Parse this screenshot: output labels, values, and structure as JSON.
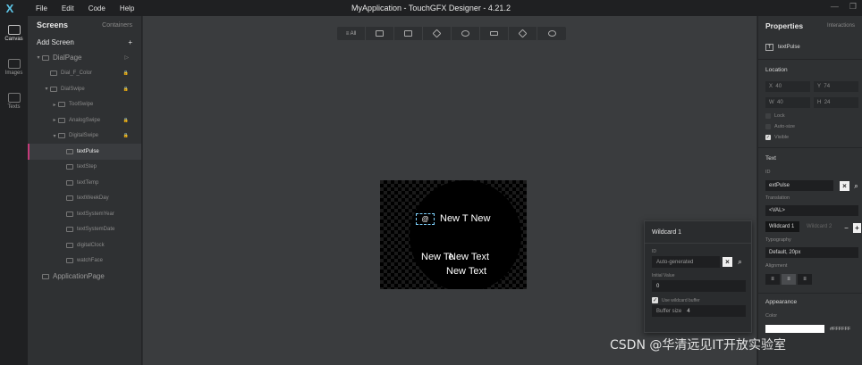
{
  "app": {
    "title": "MyApplication - TouchGFX Designer - 4.21.2",
    "menu": [
      "File",
      "Edit",
      "Code",
      "Help"
    ],
    "logo_glyph": "X"
  },
  "leftbar": [
    {
      "label": "Canvas",
      "icon": "canvas-icon",
      "active": true
    },
    {
      "label": "Images",
      "icon": "images-icon",
      "active": false
    },
    {
      "label": "Texts",
      "icon": "texts-icon",
      "active": false
    }
  ],
  "screens": {
    "tab_active": "Screens",
    "tab_other": "Containers",
    "add_label": "Add Screen",
    "add_glyph": "+",
    "tree": [
      {
        "label": "DialPage",
        "indent": 0,
        "kind": "screen",
        "arrow": "▾",
        "extra": "▷"
      },
      {
        "label": "Dial_F_Color",
        "indent": 1,
        "lock": true
      },
      {
        "label": "DialSwipe",
        "indent": 1,
        "arrow": "▾",
        "lock": true
      },
      {
        "label": "ToolSwipe",
        "indent": 2,
        "arrow": "▸"
      },
      {
        "label": "AnalogSwipe",
        "indent": 2,
        "arrow": "▸",
        "lock": true
      },
      {
        "label": "DigitalSwipe",
        "indent": 2,
        "arrow": "▾",
        "lock": true
      },
      {
        "label": "textPulse",
        "indent": 3,
        "selected": true
      },
      {
        "label": "textStep",
        "indent": 3
      },
      {
        "label": "textTemp",
        "indent": 3
      },
      {
        "label": "textWeekDay",
        "indent": 3
      },
      {
        "label": "textSystemYear",
        "indent": 3
      },
      {
        "label": "textSystemDate",
        "indent": 3
      },
      {
        "label": "digitalClock",
        "indent": 3
      },
      {
        "label": "watchFace",
        "indent": 3
      },
      {
        "label": "ApplicationPage",
        "indent": 0,
        "kind": "screen"
      }
    ]
  },
  "toolbar": {
    "all_label": "≡ All",
    "icons": [
      "display-icon",
      "image-icon",
      "container-icon",
      "shapes-icon",
      "button-icon",
      "cube-icon",
      "layers-icon"
    ]
  },
  "canvas": {
    "sel_glyph": "@",
    "texts": [
      "New T New",
      "New Te",
      "New Text",
      "New Text"
    ],
    "glyph_overlap": "t"
  },
  "wildcard": {
    "title": "Wildcard 1",
    "id_label": "ID",
    "id_placeholder": "Auto-generated",
    "initial_label": "Initial Value",
    "initial_value": "0",
    "use_buffer_label": "Use wildcard buffer",
    "buffer_label": "Buffer size",
    "buffer_value": "4"
  },
  "properties": {
    "title": "Properties",
    "interactions": "Interactions",
    "name": "textPulse",
    "location_label": "Location",
    "x_label": "X",
    "x": "40",
    "y_label": "Y",
    "y": "74",
    "w_label": "W",
    "w": "40",
    "h_label": "H",
    "h": "24",
    "lock": "Lock",
    "auto_size": "Auto-size",
    "visible": "Visible",
    "text_section": "Text",
    "id_label": "ID",
    "id_value": "extPulse",
    "translation_label": "Translation",
    "translation_value": "<VAL>",
    "wildcard_tab": "Wildcard 1",
    "wildcard_tab2": "Wildcard 2",
    "typography_label": "Typography",
    "typography_value": "Default, 20px",
    "alignment_label": "Alignment",
    "appearance_label": "Appearance",
    "color_label": "Color",
    "color_value": "#FFFFFF"
  },
  "watermark": "CSDN @华清远见IT开放实验室"
}
